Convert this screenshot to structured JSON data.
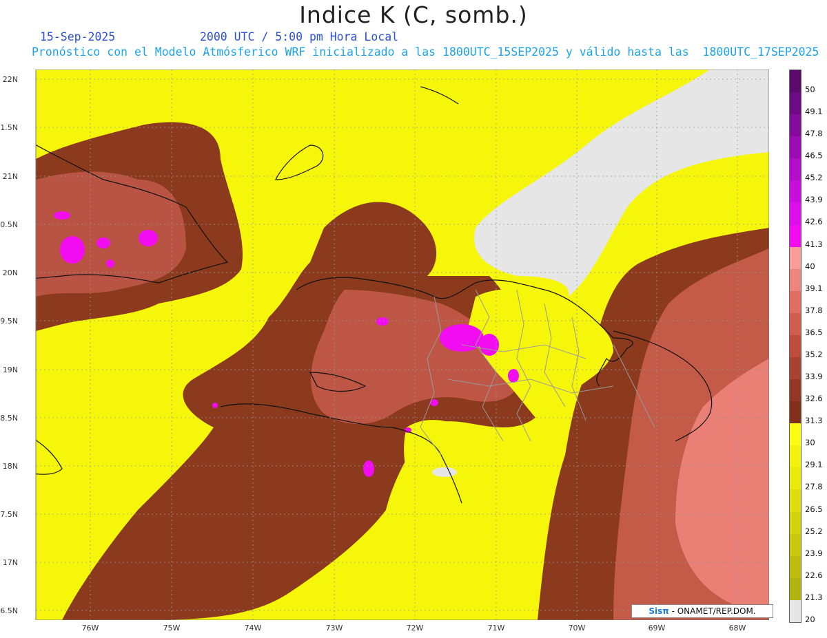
{
  "header": {
    "title": "Indice K (C, somb.)",
    "date": "15-Sep-2025",
    "valid_time": "2000 UTC / 5:00 pm Hora Local",
    "model_line": "Pronóstico con el Modelo Atmósferico WRF inicializado a las 1800UTC_15SEP2025 y válido hasta las  1800UTC_17SEP2025"
  },
  "map": {
    "latitude_labels": [
      "22N",
      "1.5N",
      "21N",
      "0.5N",
      "20N",
      "9.5N",
      "19N",
      "8.5N",
      "18N",
      "7.5N",
      "17N",
      "6.5N"
    ],
    "longitude_labels": [
      "76W",
      "75W",
      "74W",
      "73W",
      "72W",
      "71W",
      "70W",
      "69W",
      "68W"
    ],
    "colors": {
      "yellow": "#f6f60a",
      "brown_dark": "#8b3a1e",
      "brown_mid": "#a9472e",
      "salmon": "#cf6656",
      "pink": "#ea7f75",
      "magenta": "#f20cf2",
      "gray": "#e6e6e6",
      "coast": "#111111",
      "borders": "#9a9a9a"
    }
  },
  "colorbar": {
    "labels": [
      "50",
      "49.1",
      "47.8",
      "46.5",
      "45.2",
      "43.9",
      "42.6",
      "41.3",
      "40",
      "39.1",
      "37.8",
      "36.5",
      "35.2",
      "33.9",
      "32.6",
      "31.3",
      "30",
      "29.1",
      "27.8",
      "26.5",
      "25.2",
      "23.9",
      "22.6",
      "21.3",
      "20"
    ],
    "segments": [
      "#5a0a6a",
      "#6e0a84",
      "#850b9c",
      "#9b0cb4",
      "#b30dca",
      "#c90ddd",
      "#dd0ded",
      "#f20cf2",
      "#f79e98",
      "#ee857d",
      "#e06f63",
      "#cf5e4e",
      "#bd4e3d",
      "#a94230",
      "#953726",
      "#82301c",
      "#fbfb14",
      "#f2f20e",
      "#e9e90c",
      "#dede0c",
      "#d3d30d",
      "#c8c80e",
      "#bdbd0f",
      "#b3b310",
      "#e6e6e6"
    ]
  },
  "footer": {
    "brand": "Sisπ",
    "credit": " - ONAMET/REP.DOM."
  }
}
